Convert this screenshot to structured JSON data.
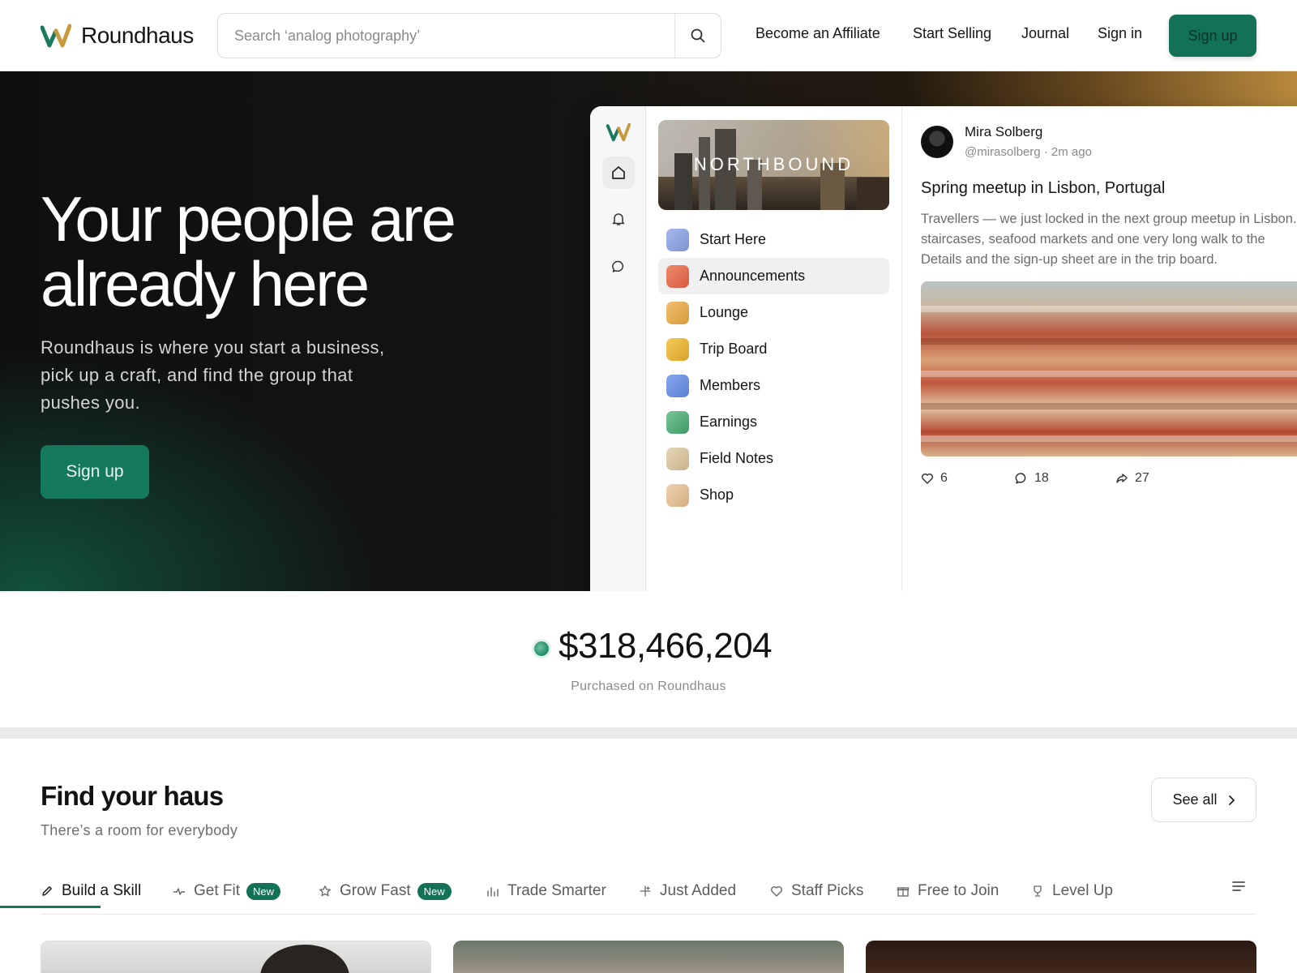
{
  "header": {
    "brand": "Roundhaus",
    "search_placeholder": "Search ‘analog photography’",
    "nav": {
      "affiliate": "Become an Affiliate",
      "selling": "Start Selling",
      "journal": "Journal",
      "signin": "Sign in",
      "signup": "Sign up"
    }
  },
  "hero": {
    "title_line1": "Your people are",
    "title_line2": "already here",
    "subtitle": "Roundhaus is where you start a business, pick up a craft, and find the group that pushes you.",
    "cta": "Sign up"
  },
  "app": {
    "banner": "NORTHBOUND",
    "channels": [
      {
        "label": "Start Here",
        "color": "#8fa3dd"
      },
      {
        "label": "Announcements",
        "color": "#e06e54"
      },
      {
        "label": "Lounge",
        "color": "#e0a94c"
      },
      {
        "label": "Trip Board",
        "color": "#e3b43c"
      },
      {
        "label": "Members",
        "color": "#6b8fdc"
      },
      {
        "label": "Earnings",
        "color": "#5bb07d"
      },
      {
        "label": "Field Notes",
        "color": "#d8c5a2"
      },
      {
        "label": "Shop",
        "color": "#e2c29c"
      }
    ],
    "post": {
      "author": "Mira Solberg",
      "handle": "@mirasolberg · 2m ago",
      "title": "Spring meetup in Lisbon, Portugal",
      "body_line1": "Travellers — we just locked in the next group meetup in Lisbon.",
      "body_line2": "staircases, seafood markets and one very long walk to the",
      "body_line3": "Details and the sign-up sheet are in the trip board.",
      "likes": "6",
      "comments": "18",
      "shares": "27"
    }
  },
  "stat": {
    "value": "$318,466,204",
    "label": "Purchased on Roundhaus"
  },
  "discover": {
    "title": "Find your haus",
    "subtitle": "There’s a room for everybody",
    "see_all": "See all",
    "tabs": [
      {
        "label": "Build a Skill",
        "icon": "pencil-icon"
      },
      {
        "label": "Get Fit",
        "icon": "pulse-icon",
        "badge": "New"
      },
      {
        "label": "Grow Fast",
        "icon": "star-icon",
        "badge": "New"
      },
      {
        "label": "Trade Smarter",
        "icon": "bars-icon"
      },
      {
        "label": "Just Added",
        "icon": "sparkle-icon"
      },
      {
        "label": "Staff Picks",
        "icon": "heart-icon"
      },
      {
        "label": "Free to Join",
        "icon": "gift-icon"
      },
      {
        "label": "Level Up",
        "icon": "trophy-icon"
      }
    ]
  },
  "colors": {
    "accent": "#127157",
    "text": "#141414",
    "muted": "#8a8a8a"
  }
}
